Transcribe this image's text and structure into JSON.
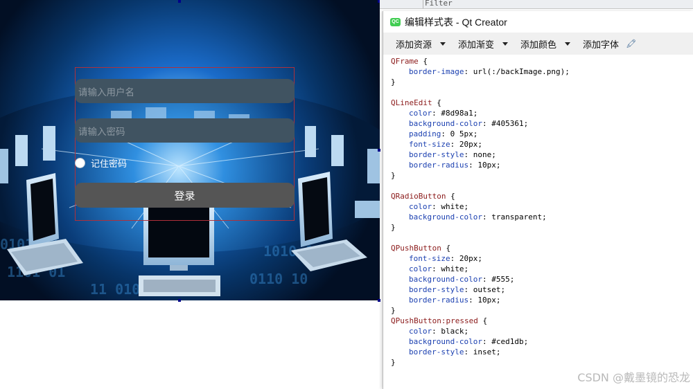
{
  "preview": {
    "username_placeholder": "请输入用户名",
    "password_placeholder": "请输入密码",
    "remember_label": "记住密码",
    "login_label": "登录"
  },
  "filter": {
    "label": "Filter"
  },
  "dialog": {
    "title": "编辑样式表 - Qt Creator",
    "logo_text": "QC",
    "toolbar": {
      "add_resource": "添加资源",
      "add_gradient": "添加渐变",
      "add_color": "添加颜色",
      "add_font": "添加字体"
    },
    "code_blocks": [
      {
        "selector": "QFrame",
        "props": [
          [
            "border-image",
            "url(:/backImage.png)"
          ]
        ]
      },
      {
        "selector": "QLineEdit",
        "props": [
          [
            "color",
            "#8d98a1"
          ],
          [
            "background-color",
            "#405361"
          ],
          [
            "padding",
            "0 5px"
          ],
          [
            "font-size",
            "20px"
          ],
          [
            "border-style",
            "none"
          ],
          [
            "border-radius",
            "10px"
          ]
        ]
      },
      {
        "selector": "QRadioButton",
        "props": [
          [
            "color",
            "white"
          ],
          [
            "background-color",
            "transparent"
          ]
        ]
      },
      {
        "selector": "QPushButton",
        "props": [
          [
            "font-size",
            "20px"
          ],
          [
            "color",
            "white"
          ],
          [
            "background-color",
            "#555"
          ],
          [
            "border-style",
            "outset"
          ],
          [
            "border-radius",
            "10px"
          ]
        ]
      },
      {
        "selector": "QPushButton:pressed",
        "props": [
          [
            "color",
            "black"
          ],
          [
            "background-color",
            "#ced1db"
          ],
          [
            "border-style",
            "inset"
          ]
        ]
      }
    ]
  },
  "watermark": "CSDN @戴墨镜的恐龙",
  "colors": {
    "line_edit_text": "#8d98a1",
    "line_edit_bg": "#405361",
    "button_bg": "#555555",
    "selector": "#8b1a1a",
    "property": "#1a3fb0",
    "qt_green": "#41cd52"
  }
}
